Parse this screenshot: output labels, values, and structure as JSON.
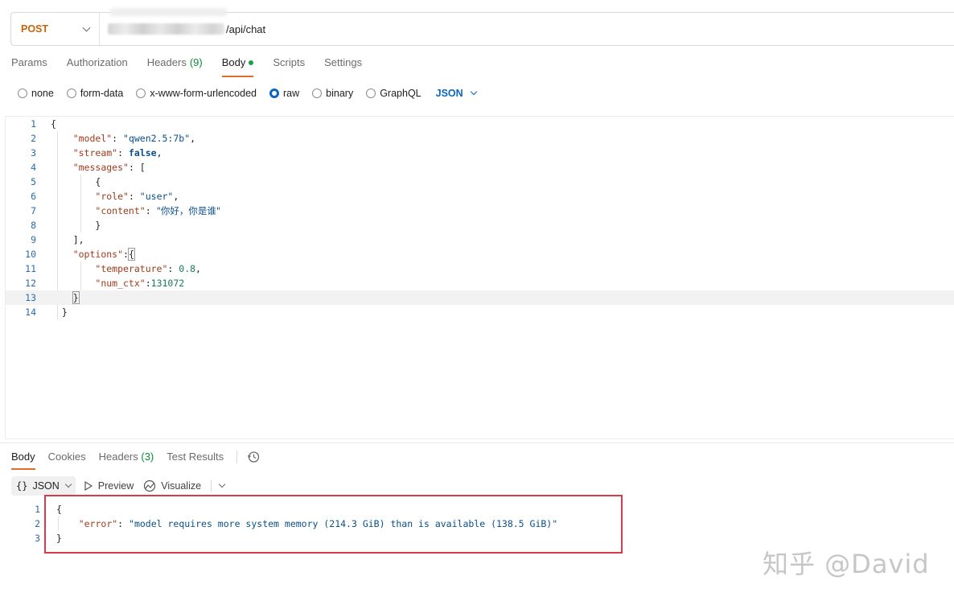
{
  "request": {
    "method": "POST",
    "url_suffix": "/api/chat"
  },
  "request_tabs": [
    {
      "label": "Params"
    },
    {
      "label": "Authorization"
    },
    {
      "label": "Headers",
      "count": "(9)"
    },
    {
      "label": "Body",
      "active": true
    },
    {
      "label": "Scripts"
    },
    {
      "label": "Settings"
    }
  ],
  "body_types": {
    "options": [
      "none",
      "form-data",
      "x-www-form-urlencoded",
      "raw",
      "binary",
      "GraphQL"
    ],
    "selected": "raw",
    "format": "JSON"
  },
  "request_body": {
    "line_numbers": [
      "1",
      "2",
      "3",
      "4",
      "5",
      "6",
      "7",
      "8",
      "9",
      "10",
      "11",
      "12",
      "13",
      "14"
    ],
    "model_key": "\"model\"",
    "model_value": "\"qwen2.5:7b\"",
    "stream_key": "\"stream\"",
    "stream_value": "false",
    "messages_key": "\"messages\"",
    "role_key": "\"role\"",
    "role_value": "\"user\"",
    "content_key": "\"content\"",
    "content_value": "\"你好，你是谁\"",
    "options_key": "\"options\"",
    "temperature_key": "\"temperature\"",
    "temperature_value": "0.8",
    "num_ctx_key": "\"num_ctx\"",
    "num_ctx_value": "131072"
  },
  "response_tabs": [
    {
      "label": "Body",
      "active": true
    },
    {
      "label": "Cookies"
    },
    {
      "label": "Headers",
      "count": "(3)"
    },
    {
      "label": "Test Results"
    }
  ],
  "response_toolbar": {
    "format": "JSON",
    "braces": "{}",
    "preview": "Preview",
    "visualize": "Visualize"
  },
  "response_body": {
    "line_numbers": [
      "1",
      "2",
      "3"
    ],
    "error_key": "\"error\"",
    "error_value": "\"model requires more system memory (214.3 GiB) than is available (138.5 GiB)\""
  },
  "watermark": "知乎 @David",
  "colors": {
    "accent_tab": "#e06d2b",
    "highlight_box": "#d63a4b",
    "radio_selected": "#0a66c2"
  }
}
